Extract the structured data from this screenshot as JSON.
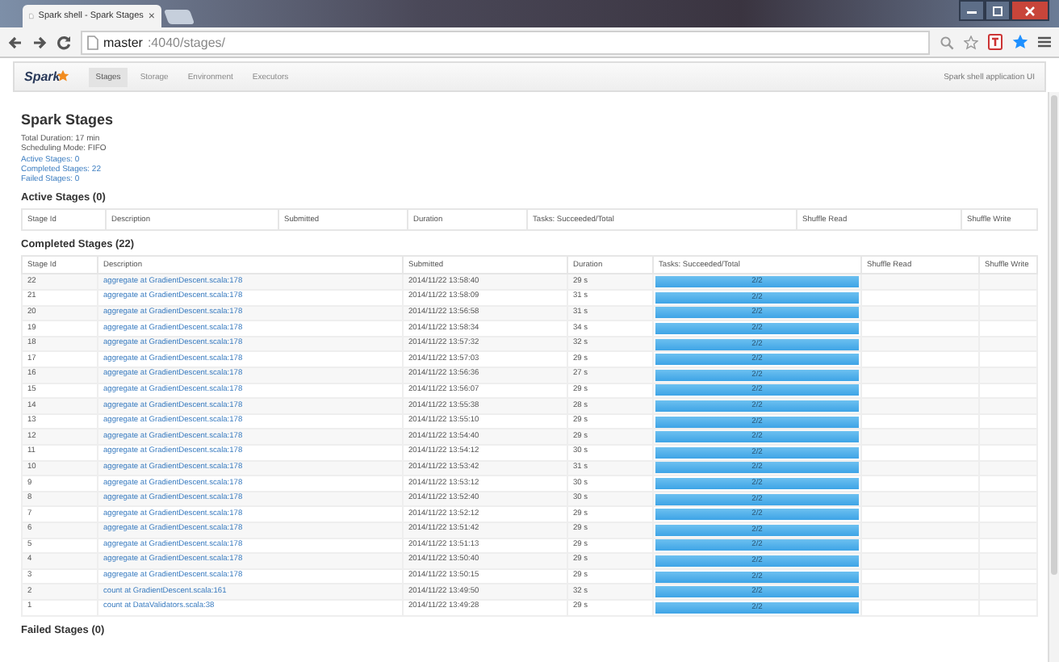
{
  "browser": {
    "tab_title": "Spark shell - Spark Stages",
    "tab_close": "×",
    "url_host": "master",
    "url_path": ":4040/stages/"
  },
  "navbar": {
    "logo": "Spark",
    "tabs": [
      {
        "label": "Stages",
        "selected": true
      },
      {
        "label": "Storage",
        "selected": false
      },
      {
        "label": "Environment",
        "selected": false
      },
      {
        "label": "Executors",
        "selected": false
      }
    ],
    "app_name": "Spark shell application UI"
  },
  "title": "Spark Stages",
  "summary": [
    {
      "label": "Total Duration:",
      "value": "17 min",
      "link": false
    },
    {
      "label": "Scheduling Mode:",
      "value": "FIFO",
      "link": false
    },
    {
      "label": "Active Stages:",
      "value": "0",
      "link": true
    },
    {
      "label": "Completed Stages:",
      "value": "22",
      "link": true
    },
    {
      "label": "Failed Stages:",
      "value": "0",
      "link": true
    }
  ],
  "active_stages": {
    "heading": "Active Stages (0)",
    "columns": [
      "Stage Id",
      "Description",
      "Submitted",
      "Duration",
      "Tasks: Succeeded/Total",
      "Shuffle Read",
      "Shuffle Write"
    ]
  },
  "completed_stages": {
    "heading": "Completed Stages (22)",
    "columns": [
      "Stage Id",
      "Description",
      "Submitted",
      "Duration",
      "Tasks: Succeeded/Total",
      "Shuffle Read",
      "Shuffle Write"
    ],
    "rows": [
      {
        "id": "22",
        "description": "aggregate at GradientDescent.scala:178",
        "submitted": "2014/11/22 13:58:40",
        "duration": "29 s",
        "tasks": "2/2",
        "level": 1
      },
      {
        "id": "21",
        "description": "aggregate at GradientDescent.scala:178",
        "submitted": "2014/11/22 13:58:09",
        "duration": "31 s",
        "tasks": "2/2",
        "level": 1
      },
      {
        "id": "20",
        "description": "aggregate at GradientDescent.scala:178",
        "submitted": "2014/11/22 13:56:58",
        "duration": "31 s",
        "tasks": "2/2",
        "level": 1
      },
      {
        "id": "19",
        "description": "aggregate at GradientDescent.scala:178",
        "submitted": "2014/11/22 13:58:34",
        "duration": "34 s",
        "tasks": "2/2",
        "level": 1
      },
      {
        "id": "18",
        "description": "aggregate at GradientDescent.scala:178",
        "submitted": "2014/11/22 13:57:32",
        "duration": "32 s",
        "tasks": "2/2",
        "level": 1
      },
      {
        "id": "17",
        "description": "aggregate at GradientDescent.scala:178",
        "submitted": "2014/11/22 13:57:03",
        "duration": "29 s",
        "tasks": "2/2",
        "level": 1
      },
      {
        "id": "16",
        "description": "aggregate at GradientDescent.scala:178",
        "submitted": "2014/11/22 13:56:36",
        "duration": "27 s",
        "tasks": "2/2",
        "level": 1
      },
      {
        "id": "15",
        "description": "aggregate at GradientDescent.scala:178",
        "submitted": "2014/11/22 13:56:07",
        "duration": "29 s",
        "tasks": "2/2",
        "level": 1
      },
      {
        "id": "14",
        "description": "aggregate at GradientDescent.scala:178",
        "submitted": "2014/11/22 13:55:38",
        "duration": "28 s",
        "tasks": "2/2",
        "level": 1
      },
      {
        "id": "13",
        "description": "aggregate at GradientDescent.scala:178",
        "submitted": "2014/11/22 13:55:10",
        "duration": "29 s",
        "tasks": "2/2",
        "level": 1
      },
      {
        "id": "12",
        "description": "aggregate at GradientDescent.scala:178",
        "submitted": "2014/11/22 13:54:40",
        "duration": "29 s",
        "tasks": "2/2",
        "level": 1
      },
      {
        "id": "11",
        "description": "aggregate at GradientDescent.scala:178",
        "submitted": "2014/11/22 13:54:12",
        "duration": "30 s",
        "tasks": "2/2",
        "level": 1
      },
      {
        "id": "10",
        "description": "aggregate at GradientDescent.scala:178",
        "submitted": "2014/11/22 13:53:42",
        "duration": "31 s",
        "tasks": "2/2",
        "level": 1
      },
      {
        "id": "9",
        "description": "aggregate at GradientDescent.scala:178",
        "submitted": "2014/11/22 13:53:12",
        "duration": "30 s",
        "tasks": "2/2",
        "level": 1
      },
      {
        "id": "8",
        "description": "aggregate at GradientDescent.scala:178",
        "submitted": "2014/11/22 13:52:40",
        "duration": "30 s",
        "tasks": "2/2",
        "level": 1
      },
      {
        "id": "7",
        "description": "aggregate at GradientDescent.scala:178",
        "submitted": "2014/11/22 13:52:12",
        "duration": "29 s",
        "tasks": "2/2",
        "level": 1
      },
      {
        "id": "6",
        "description": "aggregate at GradientDescent.scala:178",
        "submitted": "2014/11/22 13:51:42",
        "duration": "29 s",
        "tasks": "2/2",
        "level": 1
      },
      {
        "id": "5",
        "description": "aggregate at GradientDescent.scala:178",
        "submitted": "2014/11/22 13:51:13",
        "duration": "29 s",
        "tasks": "2/2",
        "level": 1
      },
      {
        "id": "4",
        "description": "aggregate at GradientDescent.scala:178",
        "submitted": "2014/11/22 13:50:40",
        "duration": "29 s",
        "tasks": "2/2",
        "level": 1
      },
      {
        "id": "3",
        "description": "aggregate at GradientDescent.scala:178",
        "submitted": "2014/11/22 13:50:15",
        "duration": "29 s",
        "tasks": "2/2",
        "level": 1
      },
      {
        "id": "2",
        "description": "count at GradientDescent.scala:161",
        "submitted": "2014/11/22 13:49:50",
        "duration": "32 s",
        "tasks": "2/2",
        "level": 1
      },
      {
        "id": "1",
        "description": "count at DataValidators.scala:38",
        "submitted": "2014/11/22 13:49:28",
        "duration": "29 s",
        "tasks": "2/2",
        "level": 1
      }
    ]
  },
  "failed_stages": {
    "heading": "Failed Stages (0)"
  }
}
